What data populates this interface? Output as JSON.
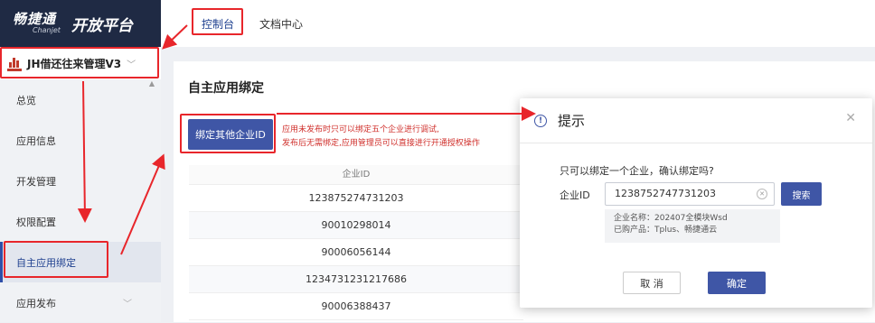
{
  "brand": {
    "name_cn": "畅捷通",
    "name_en": "Chanjet",
    "platform": "开放平台"
  },
  "app_switch": {
    "name": "JH借还往来管理V3"
  },
  "sidebar": {
    "items": [
      {
        "label": "总览"
      },
      {
        "label": "应用信息"
      },
      {
        "label": "开发管理"
      },
      {
        "label": "权限配置"
      },
      {
        "label": "自主应用绑定"
      },
      {
        "label": "应用发布"
      }
    ]
  },
  "topbar": {
    "tabs": [
      {
        "label": "控制台"
      },
      {
        "label": "文档中心"
      }
    ]
  },
  "page": {
    "title": "自主应用绑定",
    "bind_button": "绑定其他企业ID",
    "note_line1": "应用未发布时只可以绑定五个企业进行调试,",
    "note_line2": "发布后无需绑定,应用管理员可以直接进行开通授权操作"
  },
  "grid": {
    "header": "企业ID",
    "rows": [
      "1238752747312 03",
      "90010298014",
      "90006056144",
      "1234731231217686",
      "90006388437"
    ]
  },
  "dialog": {
    "title": "提示",
    "message": "只可以绑定一个企业，确认绑定吗?",
    "field_label": "企业ID",
    "field_value": "1238752747731203",
    "search_label": "搜索",
    "company_line": "企业名称：202407全模块Wsd",
    "products_line": "已购产品：Tplus、畅捷通云",
    "cancel_label": "取 消",
    "ok_label": "确定"
  },
  "colors": {
    "accent": "#3f56a6",
    "highlight": "#e8262b",
    "sidebar_dark": "#1f2a44"
  }
}
